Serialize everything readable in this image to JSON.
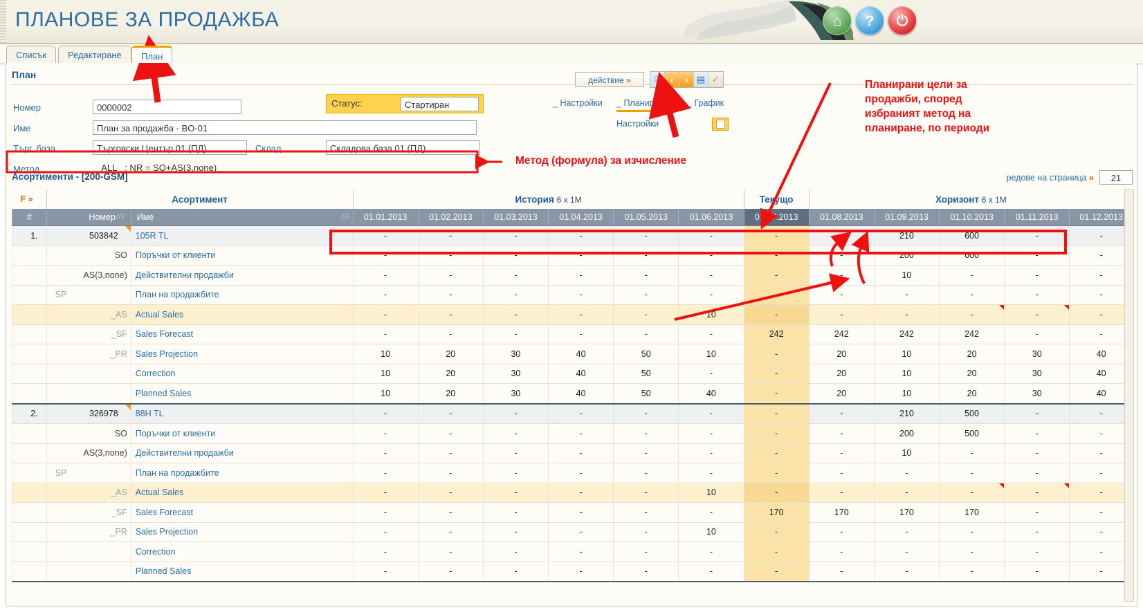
{
  "app": {
    "title": "ПЛАНОВЕ ЗА ПРОДАЖБА",
    "header_icons": [
      {
        "name": "home-icon",
        "glyph": "⌂"
      },
      {
        "name": "help-icon",
        "glyph": "?"
      },
      {
        "name": "power-icon",
        "glyph": "⏻"
      }
    ]
  },
  "tabs": [
    {
      "label": "Списък",
      "active": false
    },
    {
      "label": "Редактиране",
      "active": false
    },
    {
      "label": "План",
      "active": true
    }
  ],
  "section": {
    "title": "План"
  },
  "form": {
    "number_label": "Номер",
    "number_value": "0000002",
    "name_label": "Име",
    "name_value": "План за продажба - BO-01",
    "base_label": "Търг. база",
    "base_value": "Търговски Център 01 (ПД)",
    "store_label": "Склад",
    "store_value": "Складова база 01 (ПД)",
    "method_label": "Метод",
    "method_value": "_ALL_ : NR = SO+AS(3,none)",
    "status_label": "Статус:",
    "status_value": "Стартиран"
  },
  "toolbar": {
    "action_label": "действие",
    "action_chevron": "»",
    "buttons": [
      {
        "name": "print-button",
        "glyph": "⌸"
      },
      {
        "name": "prev-button",
        "glyph": "‹"
      },
      {
        "name": "next-button",
        "glyph": "›"
      },
      {
        "name": "calculator-button",
        "glyph": "▤"
      },
      {
        "name": "confirm-button",
        "glyph": "✓"
      }
    ]
  },
  "subtabs": [
    {
      "prefix": "_",
      "label": "Настройки",
      "active": false
    },
    {
      "prefix": "_",
      "label": "Планиране",
      "active": true
    },
    {
      "prefix": "_",
      "label": "График",
      "active": false
    }
  ],
  "settings": {
    "label": "Настройки",
    "checkbox_checked": false
  },
  "assortments_bar": {
    "title": "Асортименти",
    "separator": "-",
    "code": "[200-GSM]",
    "rows_per_page_label": "редове на страница",
    "rows_per_page_chevron": "»",
    "rows_per_page_value": "21"
  },
  "grid": {
    "filter_label": "F »",
    "group_headers": [
      {
        "title": "Асортимент",
        "sub": ""
      },
      {
        "title": "История",
        "sub": "6 x 1M"
      },
      {
        "title": "Текущо",
        "sub": ""
      },
      {
        "title": "Хоризонт",
        "sub": "6 x 1M"
      }
    ],
    "columns": {
      "index": "#",
      "number": "Номер",
      "name": "Име"
    },
    "periods": [
      "01.01.2013",
      "01.02.2013",
      "01.03.2013",
      "01.04.2013",
      "01.05.2013",
      "01.06.2013",
      "01.07.2013",
      "01.08.2013",
      "01.09.2013",
      "01.10.2013",
      "01.11.2013",
      "01.12.2013"
    ],
    "current_period_index": 6,
    "rows": [
      {
        "kind": "title",
        "idx": "1.",
        "code": "503842",
        "tag": "",
        "name": "105R TL",
        "values": [
          "-",
          "-",
          "-",
          "-",
          "-",
          "-",
          "-",
          "-",
          "210",
          "600",
          "-",
          "-"
        ]
      },
      {
        "kind": "sub",
        "idx": "",
        "code": "",
        "tag": "SO",
        "name": "Поръчки от клиенти",
        "values": [
          "-",
          "-",
          "-",
          "-",
          "-",
          "-",
          "-",
          "-",
          "200",
          "600",
          "-",
          "-"
        ]
      },
      {
        "kind": "sub",
        "idx": "",
        "code": "",
        "tag": "AS(3,none)",
        "name": "Действителни продажби",
        "values": [
          "-",
          "-",
          "-",
          "-",
          "-",
          "-",
          "-",
          "-",
          "10",
          "-",
          "-",
          "-"
        ]
      },
      {
        "kind": "sp",
        "idx": "",
        "code": "SP",
        "tag": "",
        "name": "План на продажбите",
        "values": [
          "-",
          "-",
          "-",
          "-",
          "-",
          "-",
          "-",
          "-",
          "-",
          "-",
          "-",
          "-"
        ]
      },
      {
        "kind": "as",
        "idx": "",
        "code": "",
        "tag": "_AS",
        "name": "Actual Sales",
        "values": [
          "-",
          "-",
          "-",
          "-",
          "-",
          "10",
          "-",
          "-",
          "-",
          "-",
          "-",
          "-"
        ],
        "flags": [
          false,
          false,
          false,
          false,
          false,
          false,
          false,
          false,
          false,
          true,
          true,
          false
        ]
      },
      {
        "kind": "sub",
        "idx": "",
        "code": "",
        "tag": "_SF",
        "name": "Sales Forecast",
        "values": [
          "-",
          "-",
          "-",
          "-",
          "-",
          "-",
          "242",
          "242",
          "242",
          "242",
          "-",
          "-"
        ]
      },
      {
        "kind": "sub",
        "idx": "",
        "code": "",
        "tag": "_PR",
        "name": "Sales Projection",
        "values": [
          "10",
          "20",
          "30",
          "40",
          "50",
          "10",
          "-",
          "20",
          "10",
          "20",
          "30",
          "40"
        ]
      },
      {
        "kind": "sub",
        "idx": "",
        "code": "",
        "tag": "",
        "name": "Correction",
        "values": [
          "10",
          "20",
          "30",
          "40",
          "50",
          "-",
          "-",
          "20",
          "10",
          "20",
          "30",
          "40"
        ]
      },
      {
        "kind": "sub",
        "idx": "",
        "code": "",
        "tag": "",
        "name": "Planned Sales",
        "group_end": true,
        "values": [
          "10",
          "20",
          "30",
          "40",
          "50",
          "40",
          "-",
          "20",
          "10",
          "20",
          "30",
          "40"
        ]
      },
      {
        "kind": "title",
        "idx": "2.",
        "code": "326978",
        "tag": "",
        "name": "88H TL",
        "values": [
          "-",
          "-",
          "-",
          "-",
          "-",
          "-",
          "-",
          "-",
          "210",
          "500",
          "-",
          "-"
        ]
      },
      {
        "kind": "sub",
        "idx": "",
        "code": "",
        "tag": "SO",
        "name": "Поръчки от клиенти",
        "values": [
          "-",
          "-",
          "-",
          "-",
          "-",
          "-",
          "-",
          "-",
          "200",
          "500",
          "-",
          "-"
        ]
      },
      {
        "kind": "sub",
        "idx": "",
        "code": "",
        "tag": "AS(3,none)",
        "name": "Действителни продажби",
        "values": [
          "-",
          "-",
          "-",
          "-",
          "-",
          "-",
          "-",
          "-",
          "10",
          "-",
          "-",
          "-"
        ]
      },
      {
        "kind": "sp",
        "idx": "",
        "code": "SP",
        "tag": "",
        "name": "План на продажбите",
        "values": [
          "-",
          "-",
          "-",
          "-",
          "-",
          "-",
          "-",
          "-",
          "-",
          "-",
          "-",
          "-"
        ]
      },
      {
        "kind": "as",
        "idx": "",
        "code": "",
        "tag": "_AS",
        "name": "Actual Sales",
        "values": [
          "-",
          "-",
          "-",
          "-",
          "-",
          "10",
          "-",
          "-",
          "-",
          "-",
          "-",
          "-"
        ],
        "flags": [
          false,
          false,
          false,
          false,
          false,
          false,
          false,
          false,
          false,
          true,
          true,
          false
        ]
      },
      {
        "kind": "sub",
        "idx": "",
        "code": "",
        "tag": "_SF",
        "name": "Sales Forecast",
        "values": [
          "-",
          "-",
          "-",
          "-",
          "-",
          "-",
          "170",
          "170",
          "170",
          "170",
          "-",
          "-"
        ]
      },
      {
        "kind": "sub",
        "idx": "",
        "code": "",
        "tag": "_PR",
        "name": "Sales Projection",
        "values": [
          "-",
          "-",
          "-",
          "-",
          "-",
          "10",
          "-",
          "-",
          "-",
          "-",
          "-",
          "-"
        ]
      },
      {
        "kind": "sub",
        "idx": "",
        "code": "",
        "tag": "",
        "name": "Correction",
        "values": [
          "-",
          "-",
          "-",
          "-",
          "-",
          "-",
          "-",
          "-",
          "-",
          "-",
          "-",
          "-"
        ]
      },
      {
        "kind": "sub",
        "idx": "",
        "code": "",
        "tag": "",
        "name": "Planned Sales",
        "group_end": true,
        "values": [
          "-",
          "-",
          "-",
          "-",
          "-",
          "-",
          "-",
          "-",
          "-",
          "-",
          "-",
          "-"
        ]
      }
    ]
  },
  "annotations": {
    "method_note": "Метод (формула) за изчисление",
    "planned_note_lines": [
      "Планирани цели за",
      "продажби, според",
      "избраният метод на",
      "планиране, по периоди"
    ]
  },
  "colors": {
    "accent_blue": "#2b6ca3",
    "accent_orange": "#f0a000",
    "annotation_red": "#ee1111",
    "status_yellow": "#ffd24d",
    "header_grey": "#8896a6",
    "current_col": "#fbe3a8"
  }
}
